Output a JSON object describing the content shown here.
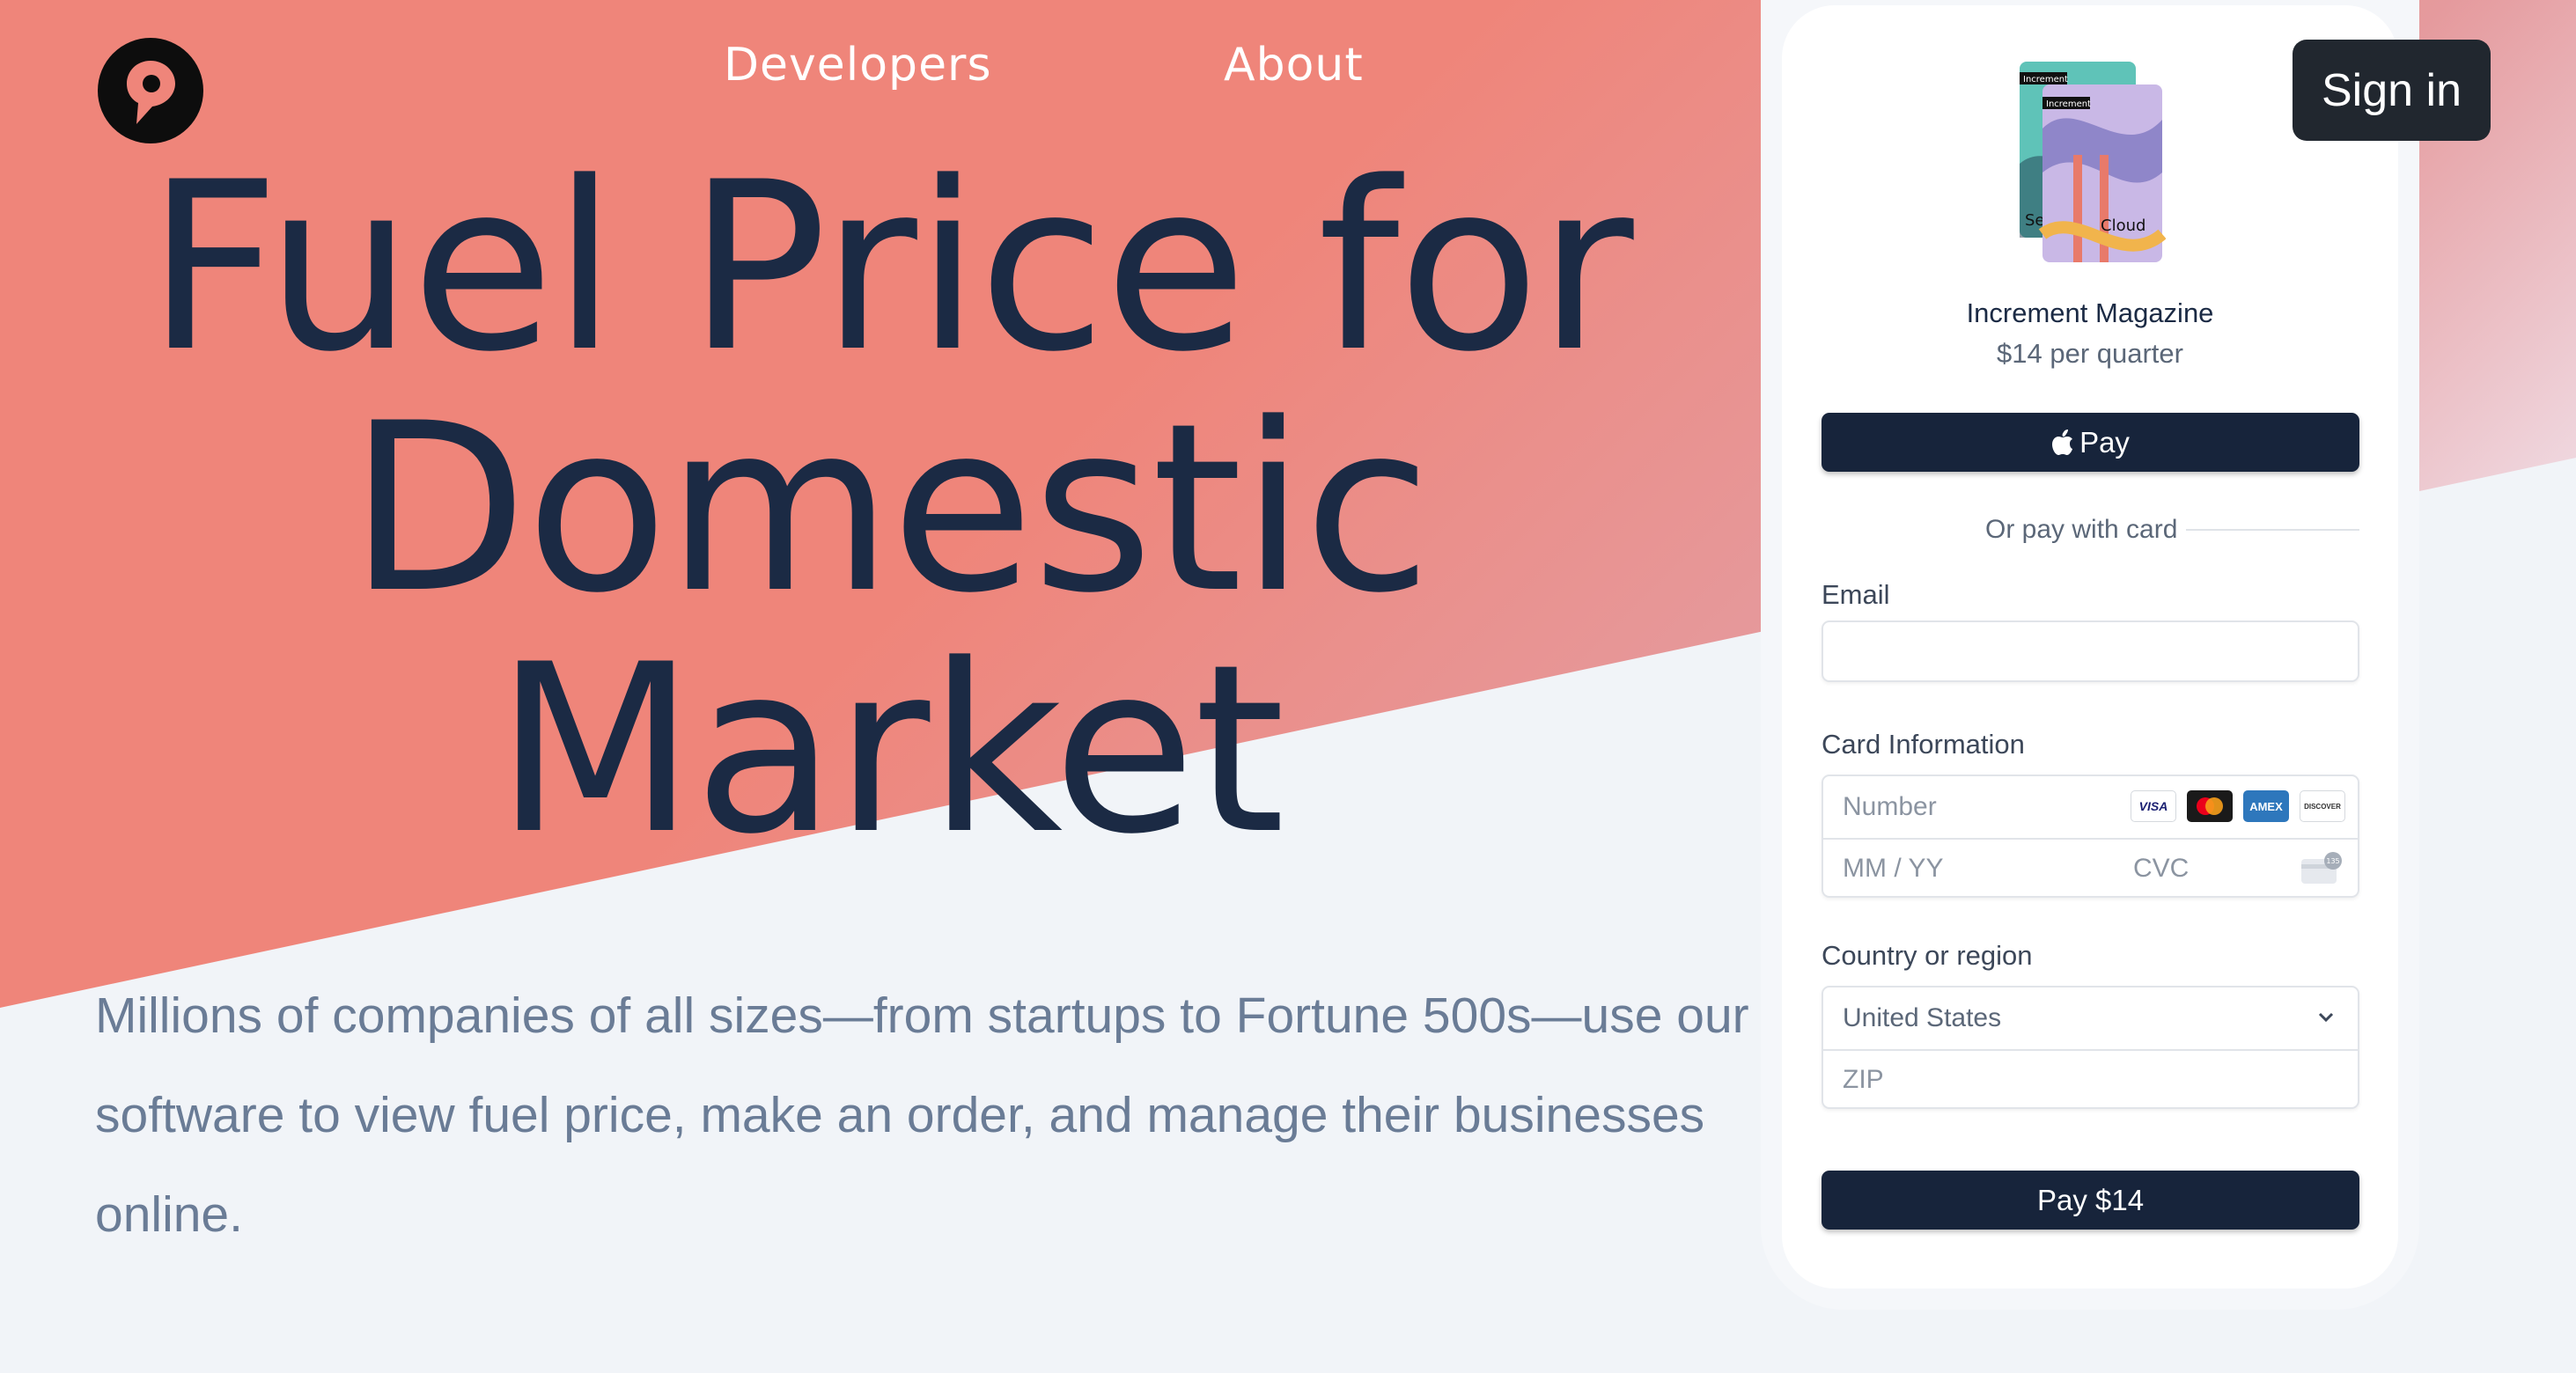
{
  "nav": {
    "links": [
      "Developers",
      "About"
    ],
    "sign_in": "Sign in"
  },
  "hero": {
    "title_lines": [
      "Fuel Price for",
      "Domestic",
      "Market"
    ],
    "subtitle": "Millions of companies of all sizes—from startups to Fortune 500s—use our software to view fuel price, make an order, and manage their businesses online."
  },
  "checkout": {
    "product_image_labels": [
      "Increment",
      "Increment",
      "Se",
      "Cloud"
    ],
    "product_name": "Increment Magazine",
    "product_price": "$14 per quarter",
    "apple_pay_label": "Pay",
    "divider_text": "Or pay with card",
    "email_label": "Email",
    "email_value": "",
    "card_label": "Card Information",
    "card_number_placeholder": "Number",
    "card_brands": [
      "VISA",
      "mastercard",
      "AMEX",
      "DISCOVER"
    ],
    "expiry_placeholder": "MM / YY",
    "cvc_placeholder": "CVC",
    "cvc_badge": "135",
    "country_label": "Country or region",
    "country_value": "United States",
    "zip_placeholder": "ZIP",
    "pay_button": "Pay $14"
  },
  "colors": {
    "hero_bg": "#ef857a",
    "page_bg": "#f1f4f8",
    "title_text": "#1b2a44",
    "subtitle_text": "#6a7c96",
    "button_dark": "#17243b",
    "signin_bg": "#21272f"
  },
  "icons": [
    "location-pin-logo-icon",
    "apple-icon",
    "chevron-down-icon",
    "cvc-card-icon",
    "visa-icon",
    "mastercard-icon",
    "amex-icon",
    "discover-icon"
  ]
}
